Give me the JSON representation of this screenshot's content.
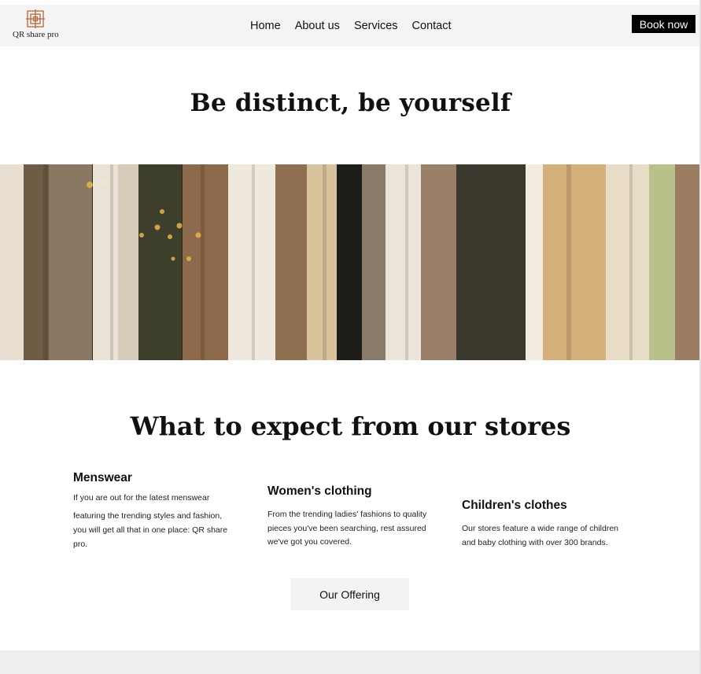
{
  "brand": {
    "logo_text": "QR share pro",
    "logo_color": "#b0673a"
  },
  "nav": {
    "items": [
      "Home",
      "About us",
      "Services",
      "Contact"
    ]
  },
  "header": {
    "book_label": "Book now"
  },
  "hero": {
    "title": "Be distinct, be yourself"
  },
  "banner": {
    "image_desc_icon": "clothes-rack-image"
  },
  "features": {
    "title": "What to expect from our stores",
    "items": [
      {
        "heading": "Menswear",
        "lines": [
          "If you are out for the latest menswear",
          "featuring the trending styles and fashion,",
          "you will get all that in one place: QR share",
          "pro."
        ]
      },
      {
        "heading": "Women's clothing",
        "lines": [
          "From the trending ladies' fashions to quality",
          "pieces you've been searching, rest assured",
          "we've got you covered."
        ]
      },
      {
        "heading": "Children's clothes",
        "lines": [
          "Our stores feature a wide range of children",
          "and baby clothing with over 300 brands."
        ]
      }
    ],
    "button_label": "Our Offering"
  },
  "colors": {
    "header_bg": "#f4f4f4",
    "button_dark": "#000000",
    "button_light": "#f3f3f3"
  }
}
